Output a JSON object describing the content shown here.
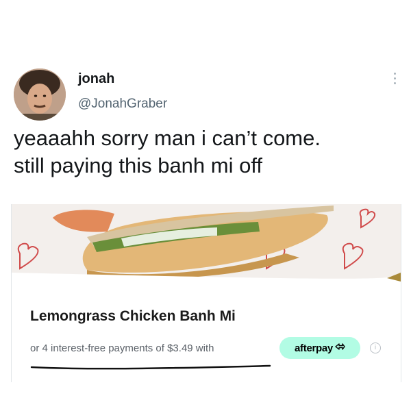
{
  "tweet": {
    "display_name": "jonah",
    "handle": "@JonahGraber",
    "text_lines": [
      "yeaaahh sorry man i can’t come.",
      "still paying this banh mi off"
    ]
  },
  "embedded_card": {
    "product_title": "Lemongrass Chicken Banh Mi",
    "installment_text": "or 4 interest-free payments of $3.49 with",
    "afterpay_label": "afterpay",
    "info_icon_glyph": "i",
    "afterpay_badge_color": "#b2fce4"
  },
  "icons": {
    "more": "more-options-icon",
    "info": "info-icon",
    "afterpay": "afterpay-logo-icon"
  }
}
